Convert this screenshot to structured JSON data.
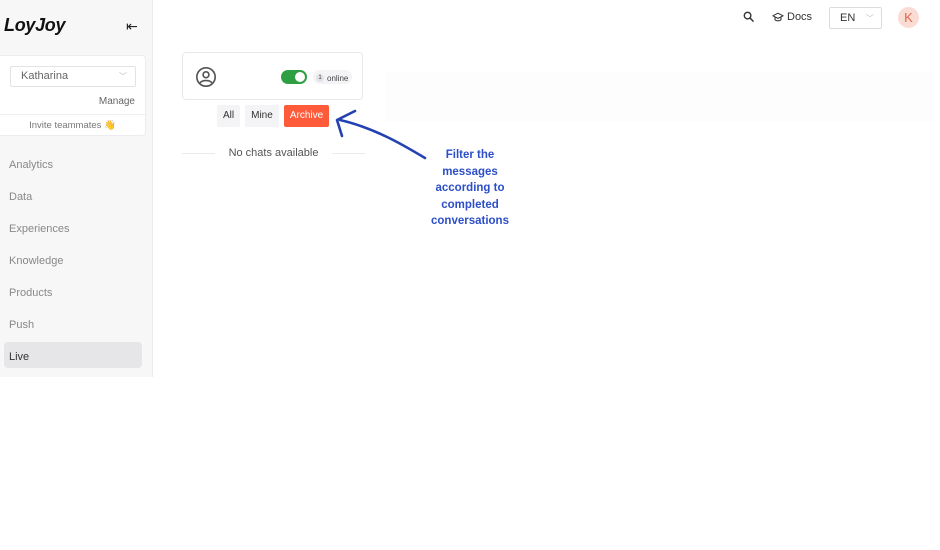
{
  "sidebar": {
    "logo": "LoyJoy",
    "collapse_icon": "collapse-left-icon",
    "account": {
      "selected": "Katharina",
      "manage_label": "Manage",
      "invite_label": "Invite teammates 👋"
    },
    "items": [
      {
        "label": "Analytics",
        "active": false
      },
      {
        "label": "Data",
        "active": false
      },
      {
        "label": "Experiences",
        "active": false
      },
      {
        "label": "Knowledge",
        "active": false
      },
      {
        "label": "Products",
        "active": false
      },
      {
        "label": "Push",
        "active": false
      },
      {
        "label": "Live",
        "active": true
      }
    ]
  },
  "topbar": {
    "search_icon": "search-icon",
    "docs_label": "Docs",
    "language": "EN",
    "avatar_initial": "K"
  },
  "live": {
    "online_count": "1",
    "online_label": "online",
    "availability_toggle_on": true,
    "filters": [
      {
        "label": "All",
        "active": false
      },
      {
        "label": "Mine",
        "active": false
      },
      {
        "label": "Archive",
        "active": true
      }
    ],
    "empty_label": "No chats available"
  },
  "annotation": {
    "text": "Filter the messages according to completed conversations",
    "color": "#2c4ec8"
  },
  "colors": {
    "accent": "#ff5b3a",
    "toggle_on": "#2ea043",
    "avatar_bg": "#fbdcd5",
    "avatar_fg": "#e3654b"
  }
}
